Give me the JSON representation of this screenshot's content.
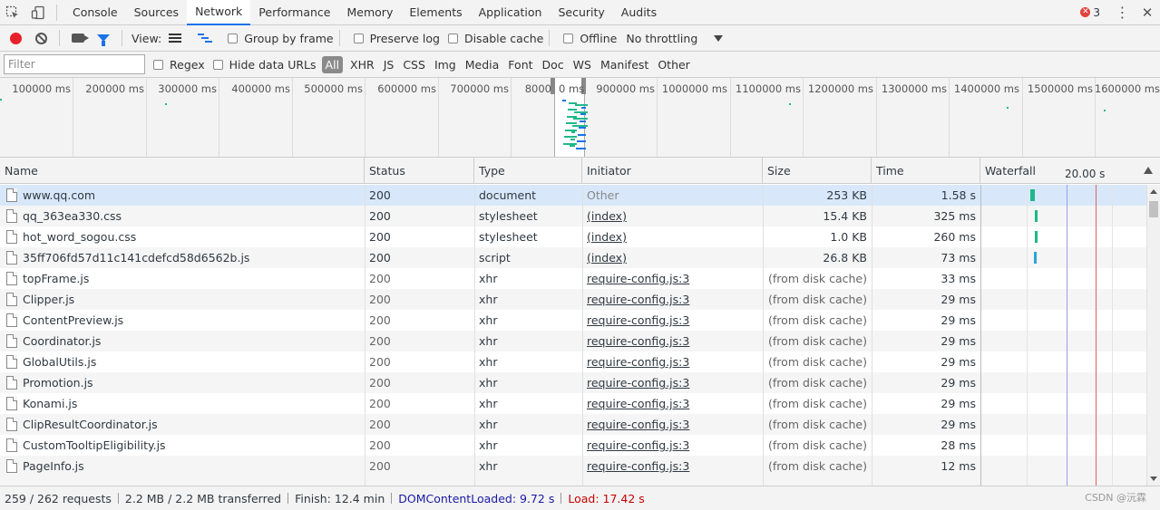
{
  "tabs": {
    "items": [
      "Console",
      "Sources",
      "Network",
      "Performance",
      "Memory",
      "Elements",
      "Application",
      "Security",
      "Audits"
    ],
    "active_index": 2,
    "error_count": "3"
  },
  "toolbar": {
    "view_label": "View:",
    "group_by_frame": "Group by frame",
    "preserve_log": "Preserve log",
    "disable_cache": "Disable cache",
    "offline": "Offline",
    "throttling": "No throttling"
  },
  "filterbar": {
    "placeholder": "Filter",
    "regex": "Regex",
    "hide_data_urls": "Hide data URLs",
    "types": [
      "All",
      "XHR",
      "JS",
      "CSS",
      "Img",
      "Media",
      "Font",
      "Doc",
      "WS",
      "Manifest",
      "Other"
    ]
  },
  "overview": {
    "labels": [
      "100000 ms",
      "200000 ms",
      "300000 ms",
      "400000 ms",
      "500000 ms",
      "600000 ms",
      "700000 ms",
      "8000",
      "0 ms",
      "900000 ms",
      "1000000 ms",
      "1100000 ms",
      "1200000 ms",
      "1300000 ms",
      "1400000 ms",
      "1500000 ms",
      "1600000 ms"
    ]
  },
  "table": {
    "headers": {
      "name": "Name",
      "status": "Status",
      "type": "Type",
      "initiator": "Initiator",
      "size": "Size",
      "time": "Time",
      "waterfall": "Waterfall",
      "waterfall_time": "20.00 s"
    },
    "rows": [
      {
        "name": "www.qq.com",
        "status": "200",
        "type": "document",
        "initiator": "Other",
        "size": "253 KB",
        "time": "1.58 s"
      },
      {
        "name": "qq_363ea330.css",
        "status": "200",
        "type": "stylesheet",
        "initiator": "(index)",
        "size": "15.4 KB",
        "time": "325 ms"
      },
      {
        "name": "hot_word_sogou.css",
        "status": "200",
        "type": "stylesheet",
        "initiator": "(index)",
        "size": "1.0 KB",
        "time": "260 ms"
      },
      {
        "name": "35ff706fd57d11c141cdefcd58d6562b.js",
        "status": "200",
        "type": "script",
        "initiator": "(index)",
        "size": "26.8 KB",
        "time": "73 ms"
      },
      {
        "name": "topFrame.js",
        "status": "200",
        "type": "xhr",
        "initiator": "require-config.js:3",
        "size": "(from disk cache)",
        "time": "33 ms"
      },
      {
        "name": "Clipper.js",
        "status": "200",
        "type": "xhr",
        "initiator": "require-config.js:3",
        "size": "(from disk cache)",
        "time": "29 ms"
      },
      {
        "name": "ContentPreview.js",
        "status": "200",
        "type": "xhr",
        "initiator": "require-config.js:3",
        "size": "(from disk cache)",
        "time": "29 ms"
      },
      {
        "name": "Coordinator.js",
        "status": "200",
        "type": "xhr",
        "initiator": "require-config.js:3",
        "size": "(from disk cache)",
        "time": "29 ms"
      },
      {
        "name": "GlobalUtils.js",
        "status": "200",
        "type": "xhr",
        "initiator": "require-config.js:3",
        "size": "(from disk cache)",
        "time": "29 ms"
      },
      {
        "name": "Promotion.js",
        "status": "200",
        "type": "xhr",
        "initiator": "require-config.js:3",
        "size": "(from disk cache)",
        "time": "29 ms"
      },
      {
        "name": "Konami.js",
        "status": "200",
        "type": "xhr",
        "initiator": "require-config.js:3",
        "size": "(from disk cache)",
        "time": "29 ms"
      },
      {
        "name": "ClipResultCoordinator.js",
        "status": "200",
        "type": "xhr",
        "initiator": "require-config.js:3",
        "size": "(from disk cache)",
        "time": "29 ms"
      },
      {
        "name": "CustomTooltipEligibility.js",
        "status": "200",
        "type": "xhr",
        "initiator": "require-config.js:3",
        "size": "(from disk cache)",
        "time": "28 ms"
      },
      {
        "name": "PageInfo.js",
        "status": "200",
        "type": "xhr",
        "initiator": "require-config.js:3",
        "size": "(from disk cache)",
        "time": "12 ms"
      }
    ]
  },
  "status": {
    "requests": "259 / 262 requests",
    "transferred": "2.2 MB / 2.2 MB transferred",
    "finish": "Finish: 12.4 min",
    "dom_content_loaded": "DOMContentLoaded: 9.72 s",
    "load": "Load: 17.42 s",
    "watermark": "CSDN @沅霖"
  },
  "colors": {
    "accent": "#1a73e8",
    "record": "#e6212a",
    "dcl_line": "#1a1aa6",
    "load_line": "#c80000",
    "waterfall_bar": "#1fb88a"
  }
}
